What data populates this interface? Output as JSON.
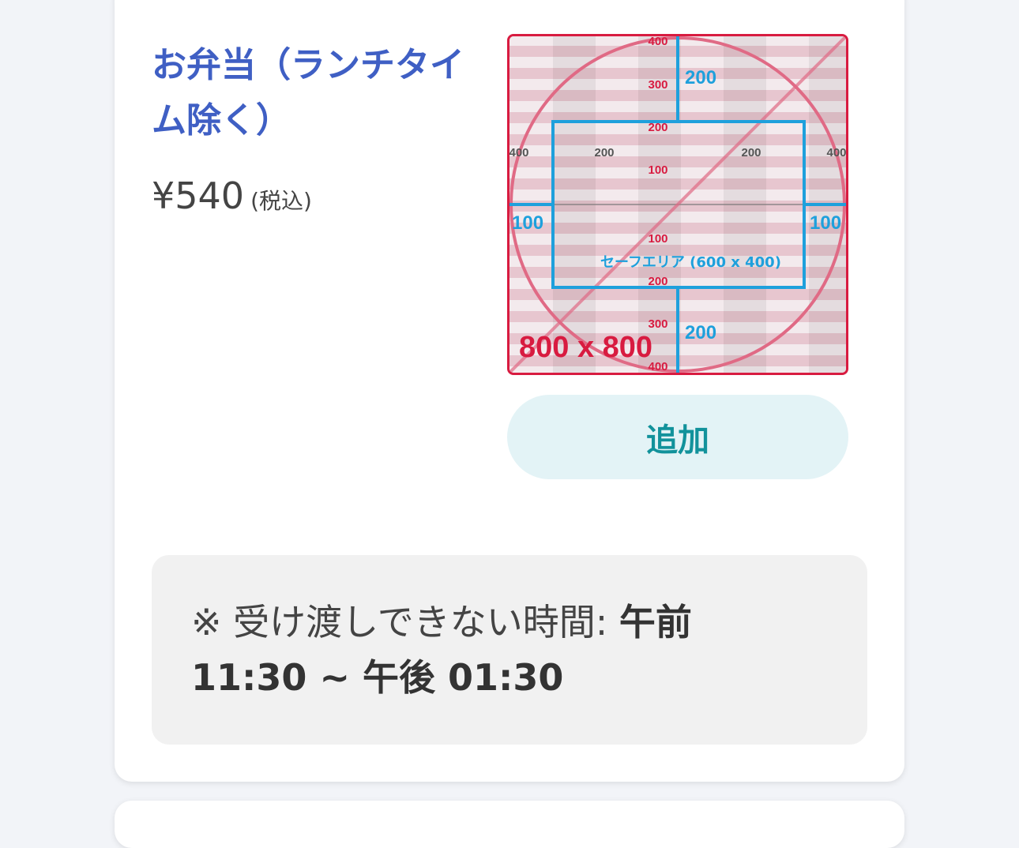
{
  "item": {
    "title": "お弁当（ランチタイム除く）",
    "price": "¥540",
    "tax_note": "(税込)",
    "add_label": "追加"
  },
  "thumbnail": {
    "size_label": "800 x 800",
    "safe_area_label": "セーフエリア (600 x 400)",
    "blue_top": "200",
    "blue_bottom": "200",
    "blue_left": "100",
    "blue_right": "100",
    "red_400_top": "400",
    "red_300_top": "300",
    "red_200_top": "200",
    "red_100_top": "100",
    "red_100_bottom": "100",
    "red_200_bottom": "200",
    "red_300_bottom": "300",
    "red_400_bottom": "400",
    "gray_400_left": "400",
    "gray_200_left": "200",
    "gray_200_right": "200",
    "gray_400_right": "400"
  },
  "notice": {
    "prefix": "※ 受け渡しできない時間: ",
    "time_range": "午前 11:30 ~ 午後 01:30"
  },
  "colors": {
    "title": "#3f5fc4",
    "accent_red": "#d81b40",
    "accent_blue": "#1ea0dc",
    "button_text": "#12929b",
    "button_bg": "#e3f3f6"
  }
}
